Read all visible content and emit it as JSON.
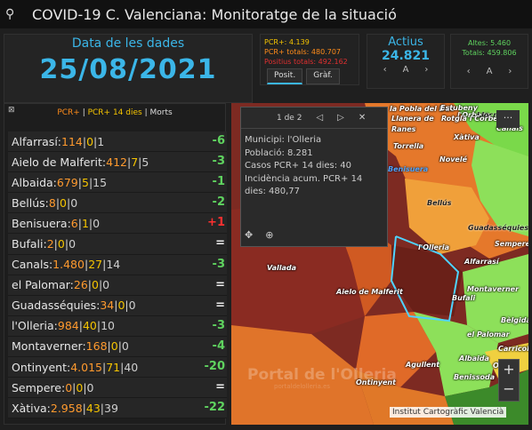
{
  "header": {
    "title": "COVID-19 C. Valenciana: Monitoratge de la situació"
  },
  "date_panel": {
    "label": "Data de les dades",
    "value": "25/08/2021"
  },
  "pcr_panel": {
    "pcr": "PCR+: 4.139",
    "pcr_total": "PCR+ totals: 480.707",
    "positius_total": "Positius totals: 492.162",
    "tab_posit": "Posit.",
    "tab_graf": "Gràf."
  },
  "actius_panel": {
    "label": "Actius",
    "value": "24.821",
    "pager": "A"
  },
  "altes_panel": {
    "altes": "Altes: 5.460",
    "totals": "Totals: 459.806",
    "pager": "A"
  },
  "list": {
    "header": {
      "p1": "PCR+",
      "sep": " | ",
      "p2": "PCR+ 14 dies",
      "sep2": " | ",
      "p3": "Morts"
    },
    "rows": [
      {
        "name": "Alfarrasí:",
        "v1": "114",
        "v2": "0",
        "v3": "1",
        "delta": "-6",
        "dc": "g"
      },
      {
        "name": "Aielo de Malferit:",
        "v1": "412",
        "v2": "7",
        "v3": "5",
        "delta": "-3",
        "dc": "g"
      },
      {
        "name": "Albaida:",
        "v1": "679",
        "v2": "5",
        "v3": "15",
        "delta": "-1",
        "dc": "g"
      },
      {
        "name": "Bellús:",
        "v1": "8",
        "v2": "0",
        "v3": "0",
        "delta": "-2",
        "dc": "g"
      },
      {
        "name": "Benisuera:",
        "v1": "6",
        "v2": "1",
        "v3": "0",
        "delta": "+1",
        "dc": "r"
      },
      {
        "name": "Bufali:",
        "v1": "2",
        "v2": "0",
        "v3": "0",
        "delta": "=",
        "dc": "w"
      },
      {
        "name": "Canals:",
        "v1": "1.480",
        "v2": "27",
        "v3": "14",
        "delta": "-3",
        "dc": "g"
      },
      {
        "name": "el Palomar:",
        "v1": "26",
        "v2": "0",
        "v3": "0",
        "delta": "=",
        "dc": "w"
      },
      {
        "name": "Guadasséquies:",
        "v1": "34",
        "v2": "0",
        "v3": "0",
        "delta": "=",
        "dc": "w"
      },
      {
        "name": "l'Olleria:",
        "v1": "984",
        "v2": "40",
        "v3": "10",
        "delta": "-3",
        "dc": "g"
      },
      {
        "name": "Montaverner:",
        "v1": "168",
        "v2": "0",
        "v3": "0",
        "delta": "-4",
        "dc": "g"
      },
      {
        "name": "Ontinyent:",
        "v1": "4.015",
        "v2": "71",
        "v3": "40",
        "delta": "-20",
        "dc": "g"
      },
      {
        "name": "Sempere:",
        "v1": "0",
        "v2": "0",
        "v3": "0",
        "delta": "=",
        "dc": "w"
      },
      {
        "name": "Xàtiva:",
        "v1": "2.958",
        "v2": "43",
        "v3": "39",
        "delta": "-22",
        "dc": "g"
      }
    ]
  },
  "map": {
    "popup": {
      "pager": "1 de 2",
      "municipi": "Municipi: l'Olleria",
      "poblacio": "Població: 8.281",
      "casos": "Casos PCR+ 14 dies: 40",
      "incidencia": "Incidència acum. PCR+ 14 dies: 480,77"
    },
    "labels": [
      "la Pobla del Duc",
      "Estubeny",
      "l'Orbera",
      "Llocnou",
      "Xàtiva",
      "Torrella",
      "Novelé",
      "Bellús",
      "Guadasséquies",
      "Sempere",
      "l'Olleria",
      "Alfarrasí",
      "Vallada",
      "Aielo de Malferit",
      "Montaverner",
      "Bufali",
      "Bèlgida",
      "el Palomar",
      "Albaida",
      "Carricola",
      "Benissoda",
      "Agullent",
      "Ontinyent",
      "Ranes",
      "Llanera de",
      "Rotglà i Corberà",
      "Benisuera",
      "Otos",
      "Canals"
    ],
    "watermark": "Portal de l'Olleria",
    "watermark_sub": "portaldelolleria.es",
    "attribution": "Institut Cartogràfic Valencià"
  },
  "colors": {
    "accent": "#3bb6e8",
    "pcr": "#ff8c1a",
    "pcr14": "#f5c400",
    "green": "#5fd35f",
    "red": "#ff3030"
  }
}
